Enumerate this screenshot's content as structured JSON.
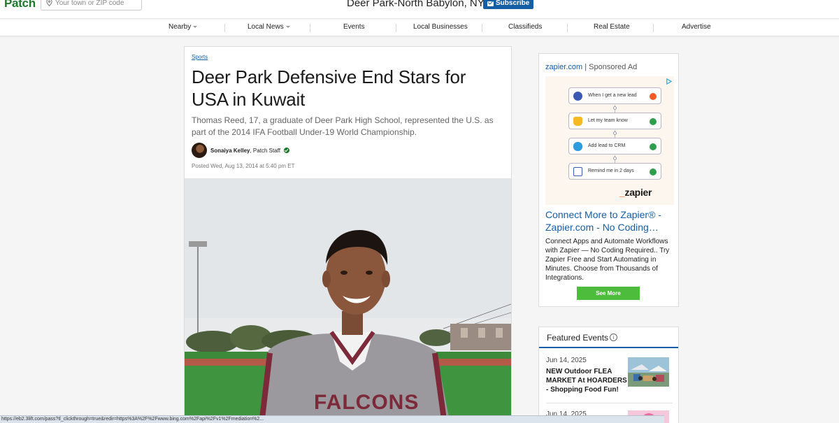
{
  "header": {
    "logo": "Patch",
    "search_placeholder": "Your town or ZIP code",
    "town": "Deer Park-North Babylon, NY",
    "subscribe_label": "Subscribe"
  },
  "nav": {
    "items": [
      {
        "label": "Nearby",
        "dropdown": true
      },
      {
        "label": "Local News",
        "dropdown": true
      },
      {
        "label": "Events",
        "dropdown": false
      },
      {
        "label": "Local Businesses",
        "dropdown": false
      },
      {
        "label": "Classifieds",
        "dropdown": false
      },
      {
        "label": "Real Estate",
        "dropdown": false
      },
      {
        "label": "Advertise",
        "dropdown": false
      }
    ]
  },
  "article": {
    "category": "Sports",
    "headline": "Deer Park Defensive End Stars for USA in Kuwait",
    "dek": "Thomas Reed, 17, a graduate of Deer Park High School, represented the U.S. as part of the 2014 IFA Football Under-19 World Championship.",
    "author_name": "Sonaiya Kelley",
    "author_role": ", Patch Staff",
    "posted": "Posted Wed, Aug 13, 2014 at 5:40 pm ET",
    "photo_jersey_text": "FALCONS"
  },
  "ad": {
    "source_domain": "zapier.com",
    "source_suffix": " | Sponsored Ad",
    "steps": [
      {
        "text": "When I get a new lead",
        "icon": "arrow-icon",
        "status": "alert"
      },
      {
        "text": "Let my team know",
        "icon": "bell-icon",
        "status": "done"
      },
      {
        "text": "Add lead to CRM",
        "icon": "cloud-icon",
        "status": "done"
      },
      {
        "text": "Remind me in 2 days",
        "icon": "calendar-icon",
        "status": "done"
      }
    ],
    "brand": "zapier",
    "title": "Connect More to Zapier® - Zapier.com - No Coding…",
    "body": "Connect Apps and Automate Workflows with Zapier — No Coding Required.. Try Zapier Free and Start Automating in Minutes. Choose from Thousands of Integrations.",
    "button_label": "See More"
  },
  "events": {
    "title": "Featured Events",
    "info_glyph": "i",
    "items": [
      {
        "date": "Jun 14, 2025",
        "name": "NEW Outdoor FLEA MARKET At HOARDERS - Shopping Food Fun!"
      },
      {
        "date": "Jun 14, 2025",
        "name": ""
      }
    ]
  },
  "status_url": "https://eb2.3lift.com/pass?tl_clickthrough=true&redir=https%3A%2F%2Fwww.bing.com%2Fapi%2Fv1%2Fmediation%2...",
  "colors": {
    "brand_green": "#1d7a2c",
    "link_blue": "#145ea8",
    "cta_green": "#4dbb3b",
    "zapier_orange": "#ff4f00"
  }
}
